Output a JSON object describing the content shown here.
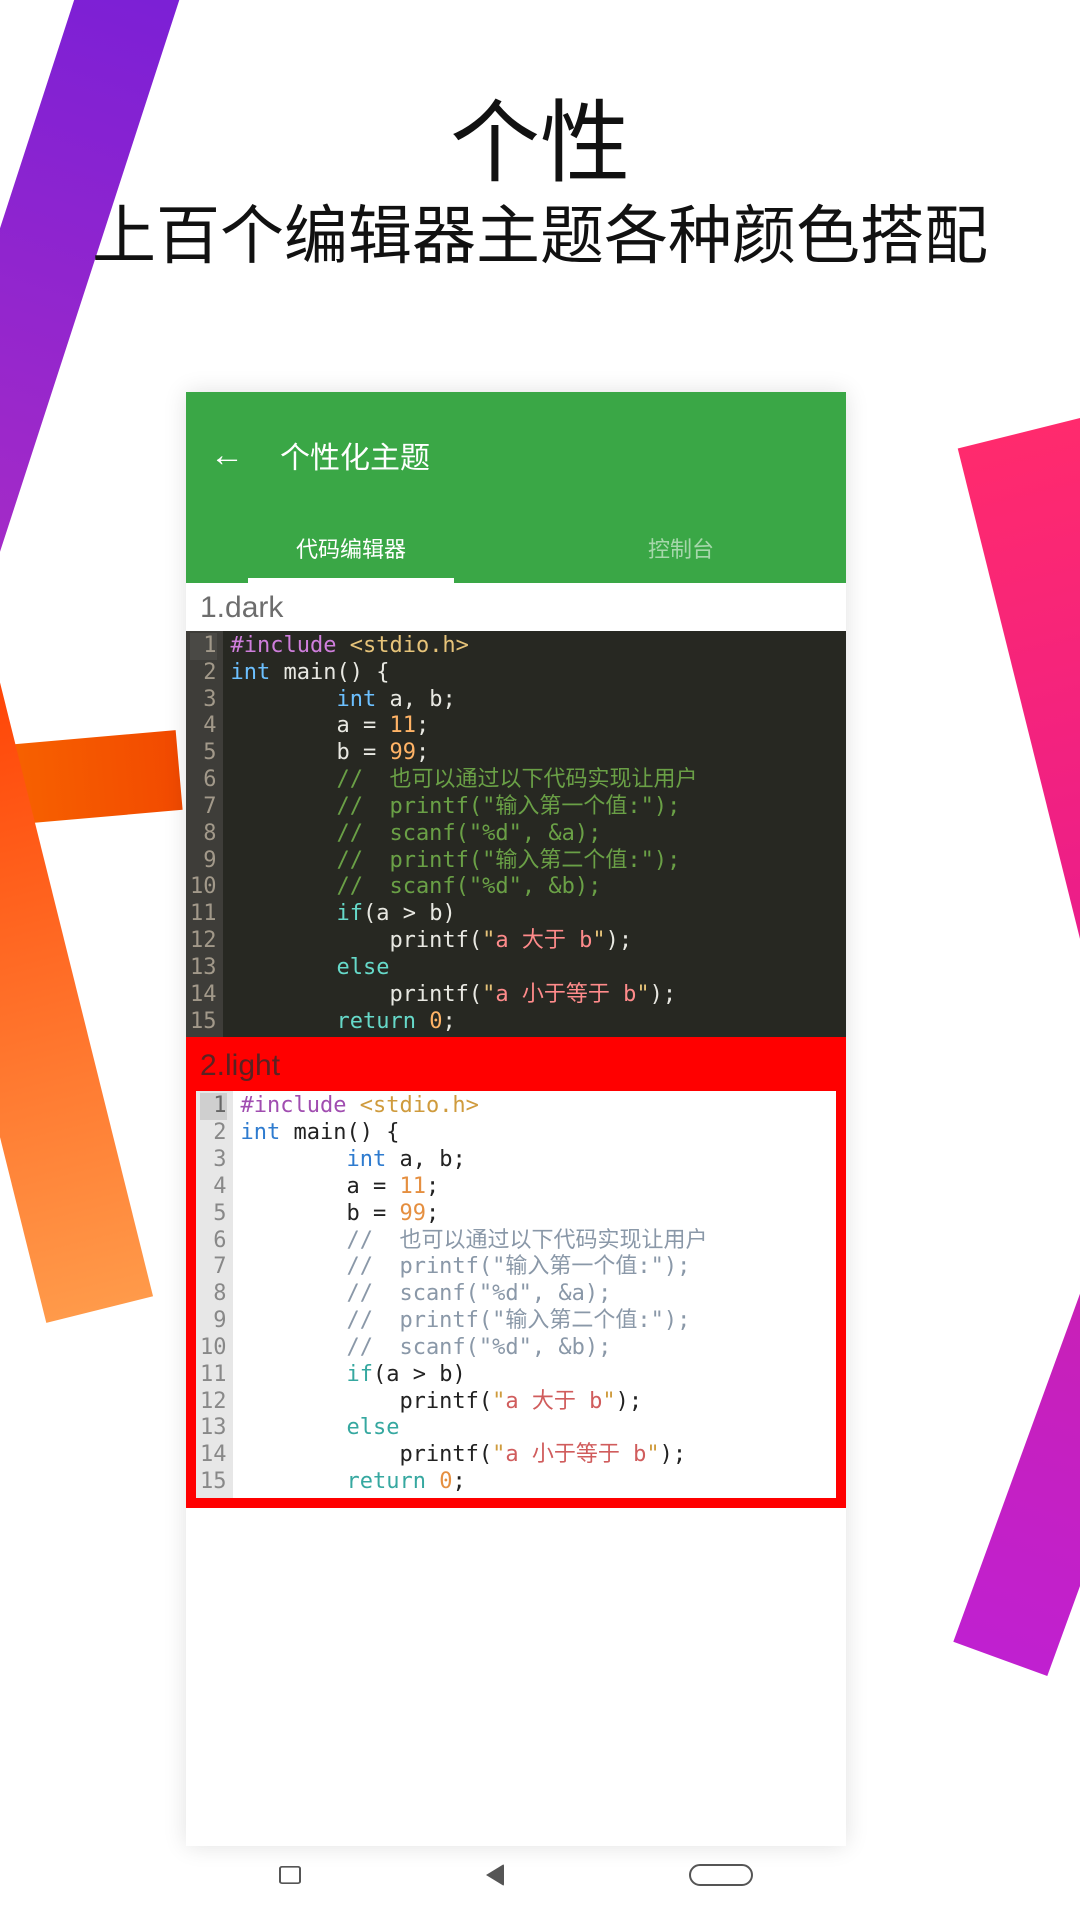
{
  "hero": {
    "title": "个性",
    "subtitle": "上百个编辑器主题各种颜色搭配"
  },
  "app": {
    "page_title": "个性化主题",
    "tabs": [
      "代码编辑器",
      "控制台"
    ],
    "active_tab": 0,
    "themes": [
      {
        "index": 1,
        "label": "1.dark",
        "variant": "dark",
        "snippet": {
          "lang": "c",
          "lines": [
            {
              "n": 1,
              "hl": true,
              "t": [
                {
                  "c": "tok-pre",
                  "s": "#include"
                },
                {
                  "s": " "
                },
                {
                  "c": "tok-str",
                  "s": "<stdio.h>"
                }
              ]
            },
            {
              "n": 2,
              "t": [
                {
                  "c": "tok-kw",
                  "s": "int"
                },
                {
                  "s": " main() {"
                }
              ]
            },
            {
              "n": 3,
              "t": [
                {
                  "s": "        "
                },
                {
                  "c": "tok-kw",
                  "s": "int"
                },
                {
                  "s": " a, b;"
                }
              ]
            },
            {
              "n": 4,
              "t": [
                {
                  "s": "        a = "
                },
                {
                  "c": "tok-num",
                  "s": "11"
                },
                {
                  "s": ";"
                }
              ]
            },
            {
              "n": 5,
              "t": [
                {
                  "s": "        b = "
                },
                {
                  "c": "tok-num",
                  "s": "99"
                },
                {
                  "s": ";"
                }
              ]
            },
            {
              "n": 6,
              "t": [
                {
                  "s": "        "
                },
                {
                  "c": "tok-com",
                  "s": "//  也可以通过以下代码实现让用户"
                }
              ]
            },
            {
              "n": 7,
              "t": [
                {
                  "s": "        "
                },
                {
                  "c": "tok-com",
                  "s": "//  printf(\"输入第一个值:\");"
                }
              ]
            },
            {
              "n": 8,
              "t": [
                {
                  "s": "        "
                },
                {
                  "c": "tok-com",
                  "s": "//  scanf(\"%d\", &a);"
                }
              ]
            },
            {
              "n": 9,
              "t": [
                {
                  "s": "        "
                },
                {
                  "c": "tok-com",
                  "s": "//  printf(\"输入第二个值:\");"
                }
              ]
            },
            {
              "n": 10,
              "t": [
                {
                  "s": "        "
                },
                {
                  "c": "tok-com",
                  "s": "//  scanf(\"%d\", &b);"
                }
              ]
            },
            {
              "n": 11,
              "t": [
                {
                  "s": "        "
                },
                {
                  "c": "tok-sec",
                  "s": "if"
                },
                {
                  "s": "(a > b)"
                }
              ]
            },
            {
              "n": 12,
              "t": [
                {
                  "s": "            printf("
                },
                {
                  "c": "tok-str",
                  "s": "\""
                },
                {
                  "c": "tok-lit",
                  "s": "a 大于 b"
                },
                {
                  "c": "tok-str",
                  "s": "\""
                },
                {
                  "s": ");"
                }
              ]
            },
            {
              "n": 13,
              "t": [
                {
                  "s": "        "
                },
                {
                  "c": "tok-sec",
                  "s": "else"
                }
              ]
            },
            {
              "n": 14,
              "t": [
                {
                  "s": "            printf("
                },
                {
                  "c": "tok-str",
                  "s": "\""
                },
                {
                  "c": "tok-lit",
                  "s": "a 小于等于 b"
                },
                {
                  "c": "tok-str",
                  "s": "\""
                },
                {
                  "s": ");"
                }
              ]
            },
            {
              "n": 15,
              "t": [
                {
                  "s": "        "
                },
                {
                  "c": "tok-sec",
                  "s": "return"
                },
                {
                  "s": " "
                },
                {
                  "c": "tok-num",
                  "s": "0"
                },
                {
                  "s": ";"
                }
              ]
            }
          ]
        }
      },
      {
        "index": 2,
        "label": "2.light",
        "variant": "light",
        "selected": true,
        "snippet": {
          "lang": "c",
          "lines": [
            {
              "n": 1,
              "hl": true,
              "t": [
                {
                  "c": "tok-pre",
                  "s": "#include"
                },
                {
                  "s": " "
                },
                {
                  "c": "tok-str",
                  "s": "<stdio.h>"
                }
              ]
            },
            {
              "n": 2,
              "t": [
                {
                  "c": "tok-kw",
                  "s": "int"
                },
                {
                  "s": " main() {"
                }
              ]
            },
            {
              "n": 3,
              "t": [
                {
                  "s": "        "
                },
                {
                  "c": "tok-kw",
                  "s": "int"
                },
                {
                  "s": " a, b;"
                }
              ]
            },
            {
              "n": 4,
              "t": [
                {
                  "s": "        a = "
                },
                {
                  "c": "tok-num",
                  "s": "11"
                },
                {
                  "s": ";"
                }
              ]
            },
            {
              "n": 5,
              "t": [
                {
                  "s": "        b = "
                },
                {
                  "c": "tok-num",
                  "s": "99"
                },
                {
                  "s": ";"
                }
              ]
            },
            {
              "n": 6,
              "t": [
                {
                  "s": "        "
                },
                {
                  "c": "tok-com",
                  "s": "//  也可以通过以下代码实现让用户"
                }
              ]
            },
            {
              "n": 7,
              "t": [
                {
                  "s": "        "
                },
                {
                  "c": "tok-com",
                  "s": "//  printf(\"输入第一个值:\");"
                }
              ]
            },
            {
              "n": 8,
              "t": [
                {
                  "s": "        "
                },
                {
                  "c": "tok-com",
                  "s": "//  scanf(\"%d\", &a);"
                }
              ]
            },
            {
              "n": 9,
              "t": [
                {
                  "s": "        "
                },
                {
                  "c": "tok-com",
                  "s": "//  printf(\"输入第二个值:\");"
                }
              ]
            },
            {
              "n": 10,
              "t": [
                {
                  "s": "        "
                },
                {
                  "c": "tok-com",
                  "s": "//  scanf(\"%d\", &b);"
                }
              ]
            },
            {
              "n": 11,
              "t": [
                {
                  "s": "        "
                },
                {
                  "c": "tok-sec",
                  "s": "if"
                },
                {
                  "s": "(a > b)"
                }
              ]
            },
            {
              "n": 12,
              "t": [
                {
                  "s": "            printf("
                },
                {
                  "c": "tok-str",
                  "s": "\""
                },
                {
                  "c": "tok-lit",
                  "s": "a 大于 b"
                },
                {
                  "c": "tok-str",
                  "s": "\""
                },
                {
                  "s": ");"
                }
              ]
            },
            {
              "n": 13,
              "t": [
                {
                  "s": "        "
                },
                {
                  "c": "tok-sec",
                  "s": "else"
                }
              ]
            },
            {
              "n": 14,
              "t": [
                {
                  "s": "            printf("
                },
                {
                  "c": "tok-str",
                  "s": "\""
                },
                {
                  "c": "tok-lit",
                  "s": "a 小于等于 b"
                },
                {
                  "c": "tok-str",
                  "s": "\""
                },
                {
                  "s": ");"
                }
              ]
            },
            {
              "n": 15,
              "t": [
                {
                  "s": "        "
                },
                {
                  "c": "tok-sec",
                  "s": "return"
                },
                {
                  "s": " "
                },
                {
                  "c": "tok-num",
                  "s": "0"
                },
                {
                  "s": ";"
                }
              ]
            }
          ]
        }
      }
    ]
  }
}
